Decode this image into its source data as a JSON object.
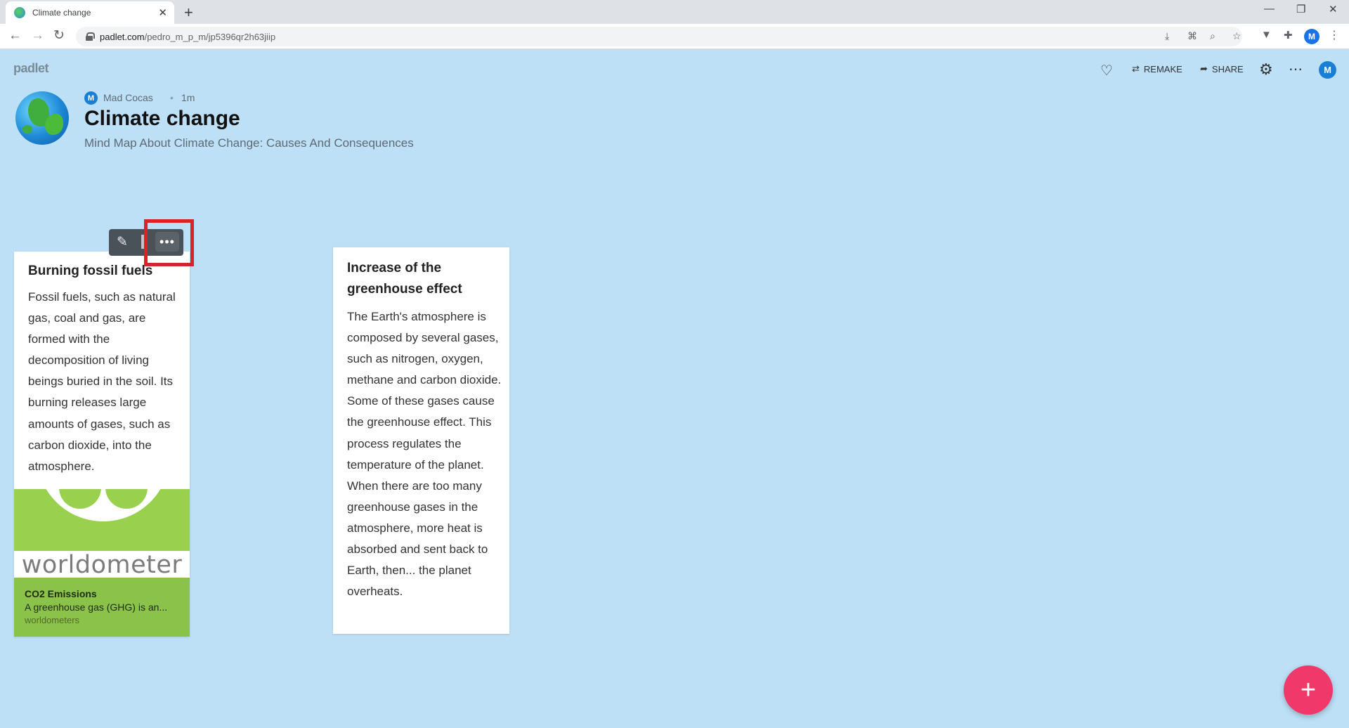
{
  "browser": {
    "tab_title": "Climate change",
    "tab_close": "✕",
    "new_tab": "+",
    "url_host": "padlet.com",
    "url_path": "/pedro_m_p_m/jp5396qr2h63jiip",
    "profile_initial": "M",
    "window_minimize": "—",
    "window_restore": "❐",
    "window_close": "✕"
  },
  "header": {
    "brand": "padlet",
    "remake_label": "REMAKE",
    "share_label": "SHARE",
    "avatar_initial": "M"
  },
  "board": {
    "author_initial": "M",
    "author": "Mad Cocas",
    "separator": "•",
    "time": "1m",
    "title": "Climate change",
    "subtitle": "Mind Map About Climate Change: Causes And Consequences"
  },
  "posts": [
    {
      "title": "Burning fossil fuels",
      "body": "Fossil fuels, such as natural gas, coal and gas, are formed with the decomposition of living beings buried in the soil. Its burning releases large amounts of gases, such as carbon dioxide, into the atmosphere.",
      "link": {
        "wordmark": "worldometer",
        "title": "CO2 Emissions",
        "description": "A greenhouse gas (GHG) is an...",
        "source": "worldometers"
      }
    },
    {
      "title": "Increase of the greenhouse effect",
      "body": "The Earth's atmosphere is composed by several gases, such as nitrogen, oxygen, methane and carbon dioxide. Some of these gases cause the greenhouse effect. This process regulates the temperature of the planet. When there are too many greenhouse gases in the atmosphere, more heat is absorbed and sent back to Earth, then... the planet overheats."
    }
  ],
  "post_actions": {
    "more_label": "•••"
  },
  "fab_label": "+",
  "colors": {
    "background": "#bde0f7",
    "fab": "#f0386b",
    "highlight": "#d9232a",
    "link_card": "#8bc34a"
  },
  "icons": [
    "heart-icon",
    "remake-icon",
    "share-icon",
    "gear-icon",
    "more-icon",
    "pencil-icon",
    "trash-icon",
    "globe-icon"
  ]
}
